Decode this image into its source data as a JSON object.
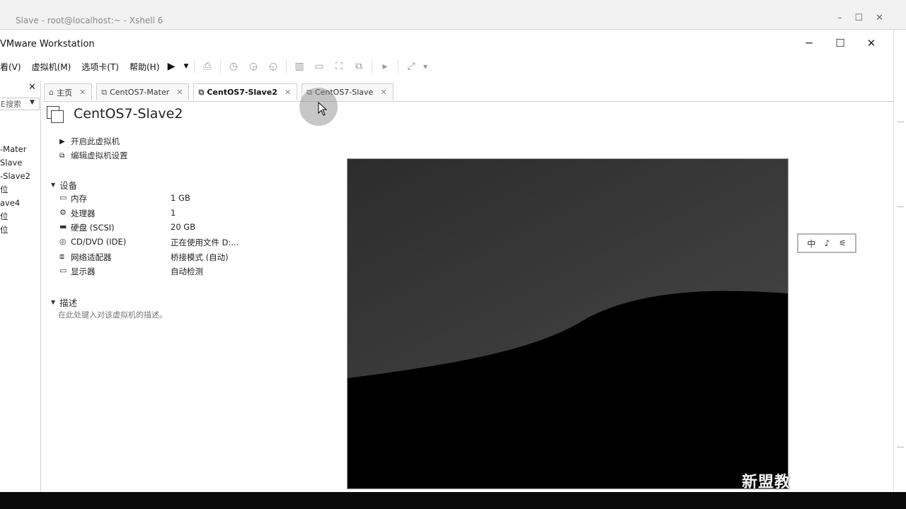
{
  "xshell": {
    "title": "Slave - root@localhost:~ - Xshell 6"
  },
  "window": {
    "title": "VMware Workstation",
    "minimize": "─",
    "maximize": "☐",
    "close": "✕"
  },
  "menu": [
    {
      "label": "看(V)"
    },
    {
      "label": "虚拟机(M)"
    },
    {
      "label": "选项卡(T)"
    },
    {
      "label": "帮助(H)"
    }
  ],
  "library": {
    "close": "✕",
    "search_placeholder": "E搜索",
    "items": [
      "-Mater",
      "Slave",
      "-Slave2",
      "位",
      "ave4",
      "位",
      "位"
    ]
  },
  "tabs": [
    {
      "icon": "home-icon",
      "label": "主页"
    },
    {
      "icon": "vm-icon",
      "label": "CentOS7-Mater"
    },
    {
      "icon": "vm-icon",
      "label": "CentOS7-Slave2",
      "active": true
    },
    {
      "icon": "vm-icon",
      "label": "CentOS7-Slave"
    }
  ],
  "vm": {
    "name": "CentOS7-Slave2",
    "actions": {
      "power_on": "开启此虚拟机",
      "edit": "编辑虚拟机设置"
    },
    "devices_header": "设备",
    "devices": [
      {
        "icon": "memory-icon",
        "name": "内存",
        "value": "1 GB"
      },
      {
        "icon": "cpu-icon",
        "name": "处理器",
        "value": "1"
      },
      {
        "icon": "disk-icon",
        "name": "硬盘 (SCSI)",
        "value": "20 GB"
      },
      {
        "icon": "cd-icon",
        "name": "CD/DVD (IDE)",
        "value": "正在使用文件 D:..."
      },
      {
        "icon": "network-icon",
        "name": "网络适配器",
        "value": "桥接模式 (自动)"
      },
      {
        "icon": "display-icon",
        "name": "显示器",
        "value": "自动检测"
      }
    ],
    "description_header": "描述",
    "description_hint": "在此处键入对该虚拟机的描述。"
  },
  "ime": {
    "a": "中",
    "b": "♪",
    "c": "⚟"
  },
  "watermark": "新盟教",
  "colors": {
    "preview_bg": "#000000",
    "preview_sky": "#3a3a3a"
  }
}
